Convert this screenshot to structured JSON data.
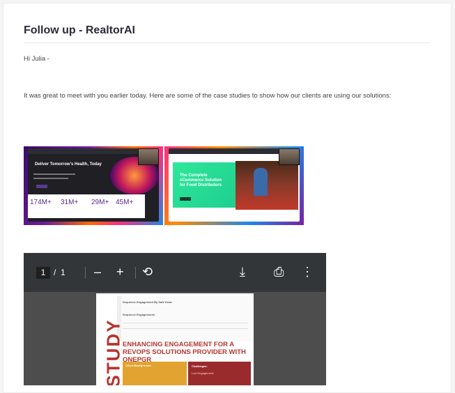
{
  "email": {
    "subject": "Follow up - RealtorAI",
    "greeting": "Hi Julia -",
    "body": "It was great to meet with you earlier today. Here are some of the case studies to show how our clients are using our solutions:"
  },
  "screenshot1": {
    "headline": "Deliver Tomorrow's Health, Today",
    "stats": [
      "174M+",
      "31M+",
      "29M+",
      "45M+"
    ]
  },
  "screenshot2": {
    "headline": "The Complete eCommerce Solution for Food Distributors"
  },
  "pdf_viewer": {
    "current_page": "1",
    "page_sep": "/",
    "total_pages": "1",
    "zoom_out": "–",
    "zoom_in": "+",
    "rotate": "⟲",
    "download": "⤓",
    "print": "⎙",
    "more": "⋮",
    "page": {
      "vertical_title": "STUDY",
      "headline": "ENHANCING ENGAGEMENT FOR A REVOPS SOLUTIONS PROVIDER WITH ONEPGR",
      "table_title": "Sequence Engagement By Safe Draw",
      "table_sub": "Sequence Engagements",
      "left_box_title": "Client Background:",
      "right_box_title": "Challenges:",
      "right_box_text": "Low Engagement:"
    }
  },
  "colors": {
    "accent_red": "#b5352e",
    "box_yellow": "#e2a330",
    "box_maroon": "#9a2b2d",
    "pdf_toolbar": "#323639"
  }
}
